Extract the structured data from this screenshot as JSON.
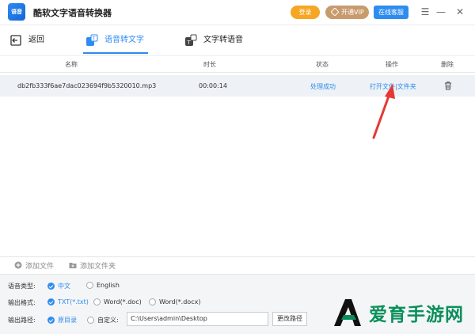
{
  "app": {
    "logo_text": "语音",
    "title": "酷软文字语音转换器",
    "login_label": "登录",
    "vip_label": "开通VIP",
    "service_label": "在线客服"
  },
  "tabs": {
    "back_label": "返回",
    "speech_to_text_label": "语音转文字",
    "text_to_speech_label": "文字转语音"
  },
  "table": {
    "headers": {
      "name": "名称",
      "duration": "时长",
      "status": "状态",
      "action": "操作",
      "delete": "删除"
    },
    "rows": [
      {
        "name": "db2fb333f6ae7dac023694f9b5320010.mp3",
        "duration": "00:00:14",
        "status": "处理成功",
        "open_file": "打开文件",
        "separator": "|",
        "folder": "文件夹"
      }
    ]
  },
  "toolbar": {
    "add_file": "添加文件",
    "add_folder": "添加文件夹"
  },
  "options": {
    "language_label": "语音类型:",
    "lang_cn": "中文",
    "lang_en": "English",
    "format_label": "输出格式:",
    "fmt_txt": "TXT(*.txt)",
    "fmt_doc": "Word(*.doc)",
    "fmt_docx": "Word(*.docx)",
    "path_label": "输出路径:",
    "path_original": "原目录",
    "path_custom": "自定义:",
    "path_value": "C:\\Users\\admin\\Desktop",
    "change_path": "更改路径"
  },
  "watermark": {
    "text": "爱育手游网"
  },
  "colors": {
    "accent": "#2d8cf0",
    "login": "#f6a623",
    "vip": "#c89b6d",
    "arrow": "#e53935",
    "watermark": "#0a8f5a"
  }
}
